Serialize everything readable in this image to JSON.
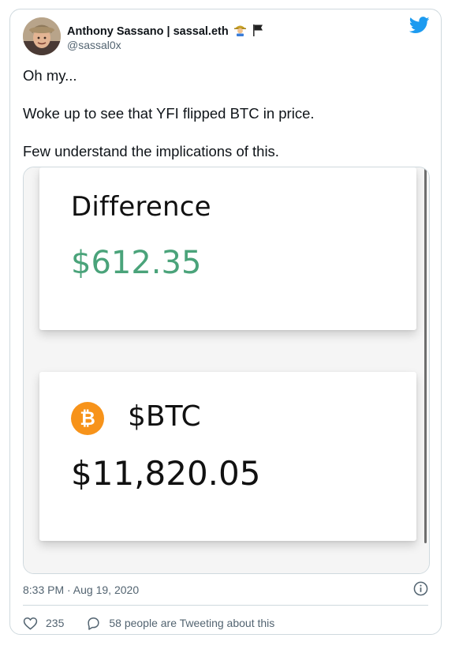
{
  "author": {
    "name": "Anthony Sassano | sassal.eth",
    "handle": "@sassal0x",
    "name_emoji": "🧑‍🌾"
  },
  "tweet": {
    "lines": [
      "Oh my...",
      "Woke up to see that YFI flipped BTC in price.",
      "Few understand the implications of this."
    ]
  },
  "media": {
    "difference_label": "Difference",
    "difference_value": "$612.35",
    "btc_symbol": "₿",
    "btc_ticker": "$BTC",
    "btc_price": "$11,820.05"
  },
  "meta": {
    "timestamp": "8:33 PM · Aug 19, 2020"
  },
  "actions": {
    "likes": "235",
    "tweeting": "58 people are Tweeting about this"
  },
  "colors": {
    "twitter_blue": "#1d9bf0",
    "difference_green": "#4aa37a",
    "bitcoin_orange": "#f7931a",
    "secondary_text": "#536471"
  },
  "icons": [
    "twitter-bird-icon",
    "farmer-emoji-icon",
    "black-flag-icon",
    "bitcoin-icon",
    "info-icon",
    "heart-icon",
    "speech-bubble-icon"
  ]
}
